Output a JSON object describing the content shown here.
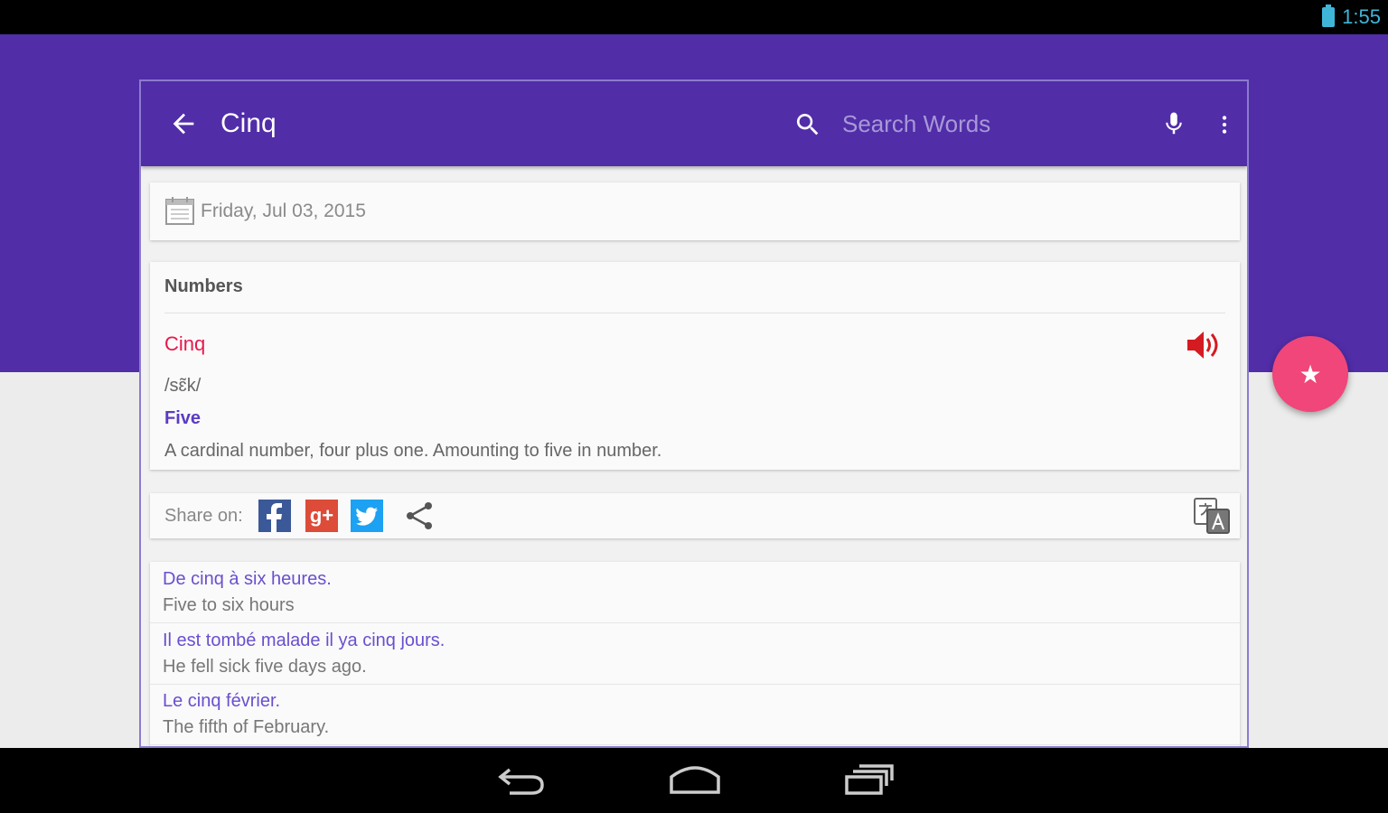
{
  "status": {
    "time": "1:55",
    "icons": [
      "battery-icon"
    ]
  },
  "toolbar": {
    "title": "Cinq",
    "search_placeholder": "Search Words",
    "icons": [
      "back-arrow-icon",
      "search-icon",
      "mic-icon",
      "more-vert-icon"
    ]
  },
  "date": {
    "text": "Friday, Jul 03, 2015",
    "icon": "calendar-icon"
  },
  "word_card": {
    "category": "Numbers",
    "word": "Cinq",
    "phonetic": "/sɛ̃k/",
    "translation": "Five",
    "definition": "A cardinal number, four plus one. Amounting to five in number.",
    "icon": "speaker-icon"
  },
  "share": {
    "label": "Share on:",
    "icons": [
      "facebook-icon",
      "google-plus-icon",
      "twitter-icon",
      "share-icon",
      "translate-icon"
    ],
    "google_plus_text": "g+"
  },
  "examples": [
    {
      "fr": "De cinq à six heures.",
      "en": "Five to six hours"
    },
    {
      "fr": "Il est tombé malade il ya cinq jours.",
      "en": "He fell sick five days ago."
    },
    {
      "fr": "Le cinq février.",
      "en": "The fifth of February."
    }
  ],
  "fab": {
    "icon": "star-icon",
    "symbol": "★"
  },
  "nav": {
    "icons": [
      "back-nav-icon",
      "home-nav-icon",
      "recents-nav-icon"
    ]
  },
  "colors": {
    "primary": "#512da8",
    "accent": "#f0467a",
    "word": "#e8174a",
    "status_text": "#3fb6d8"
  }
}
